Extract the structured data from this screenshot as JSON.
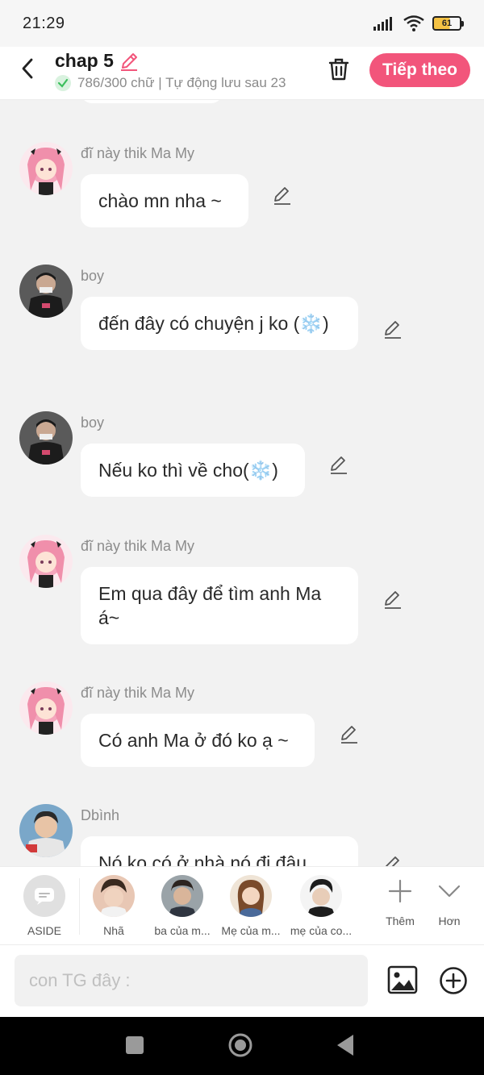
{
  "status": {
    "time": "21:29",
    "battery": "61",
    "icons": [
      "signal-icon",
      "wifi-icon",
      "battery-icon"
    ]
  },
  "header": {
    "title": "chap 5",
    "subtitle": "786/300 chữ | Tự động lưu sau 23",
    "next_label": "Tiếp theo"
  },
  "messages": [
    {
      "sender": "đĩ này thik Ma My",
      "text": "chào mn nha ~"
    },
    {
      "sender": "boy",
      "text": "đến đây có chuyện j ko (❄️)"
    },
    {
      "sender": "boy",
      "text": "Nếu ko thì về cho(❄️)"
    },
    {
      "sender": "đĩ này thik Ma My",
      "text": "Em qua đây để tìm anh Ma á~"
    },
    {
      "sender": "đĩ này thik Ma My",
      "text": "Có anh Ma ở đó ko ạ ~"
    },
    {
      "sender": "Dbình",
      "text": "Nó ko có ở nhà nó đi đâu"
    }
  ],
  "characters": [
    {
      "name": "ASIDE"
    },
    {
      "name": "Nhã"
    },
    {
      "name": "ba của m..."
    },
    {
      "name": "Mẹ của m..."
    },
    {
      "name": "mẹ của co..."
    }
  ],
  "tools": {
    "more_label": "Thêm",
    "collapse_label": "Hơn"
  },
  "input": {
    "placeholder": "con TG đây :",
    "value": ""
  },
  "colors": {
    "accent": "#f2557b",
    "background": "#f2f2f2",
    "bubble": "#ffffff"
  }
}
